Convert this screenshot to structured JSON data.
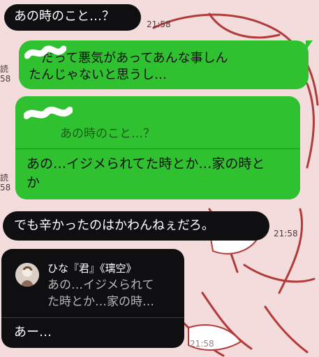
{
  "messages": [
    {
      "text": "あの時のこと…？",
      "time": "21:58"
    },
    {
      "text_line1": "　だって悪気があってあんな事しん",
      "text_line2": "たんじゃないと思うし…",
      "read_label": "読",
      "read_time": "58"
    },
    {
      "quote": "あの時のこと…？",
      "text_line1": "あの…イジメられてた時とか…家の時と",
      "text_line2": "か",
      "read_label": "読",
      "read_time": "58"
    },
    {
      "text": "でも辛かったのはかわんねぇだろ。",
      "time": "21:58"
    },
    {
      "quote_name": "ひな『君』《璃空》",
      "quote_line1": "あの…イジメられて",
      "quote_line2": "た時とか…家の時…",
      "text": "あー…",
      "time": "21:58"
    }
  ],
  "colors": {
    "dark_bubble": "#0f0f12",
    "green_bubble": "#2fc12f"
  }
}
